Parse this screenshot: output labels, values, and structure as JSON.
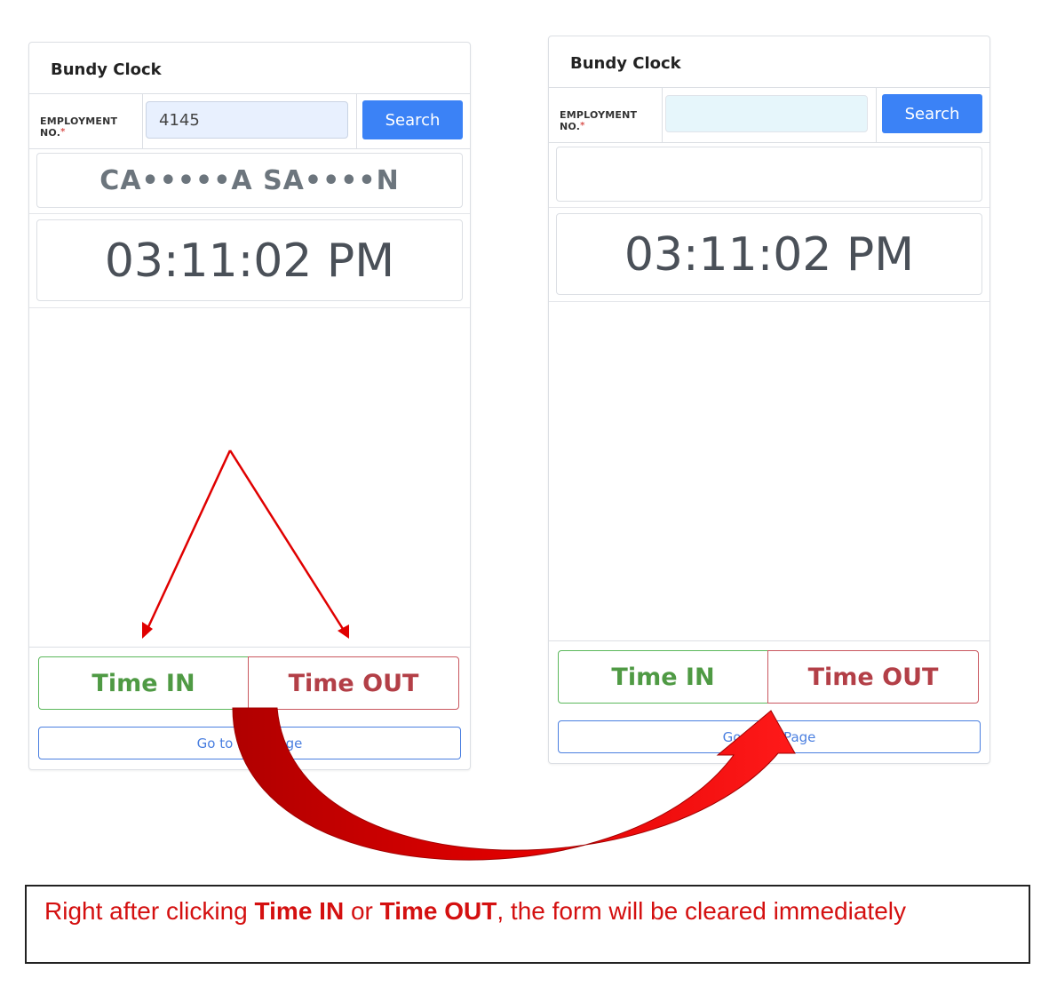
{
  "left_panel": {
    "title": "Bundy Clock",
    "employment_label": "EMPLOYMENT NO.",
    "required_mark": "*",
    "employment_value": "4145",
    "search_label": "Search",
    "employee_name": "CA•••••A SA••••N",
    "clock_time": "03:11:02 PM",
    "time_in_label": "Time IN",
    "time_out_label": "Time OUT",
    "go_label": "Go to L      Page"
  },
  "right_panel": {
    "title": "Bundy Clock",
    "employment_label": "EMPLOYMENT NO.",
    "required_mark": "*",
    "employment_value": "",
    "search_label": "Search",
    "employee_name": "",
    "clock_time": "03:11:02 PM",
    "time_in_label": "Time IN",
    "time_out_label": "Time OUT",
    "go_label": "Go          Page"
  },
  "annotation": {
    "prefix": "Right after clicking ",
    "time_in": "Time IN",
    "or": " or ",
    "time_out": "Time OUT",
    "suffix": ", the form will be cleared immediately"
  },
  "colors": {
    "accent_blue": "#3b82f6",
    "time_in_green": "#4f9a44",
    "time_out_red": "#b33f47",
    "arrow_red": "#e00000",
    "annotation_red": "#d41010"
  }
}
